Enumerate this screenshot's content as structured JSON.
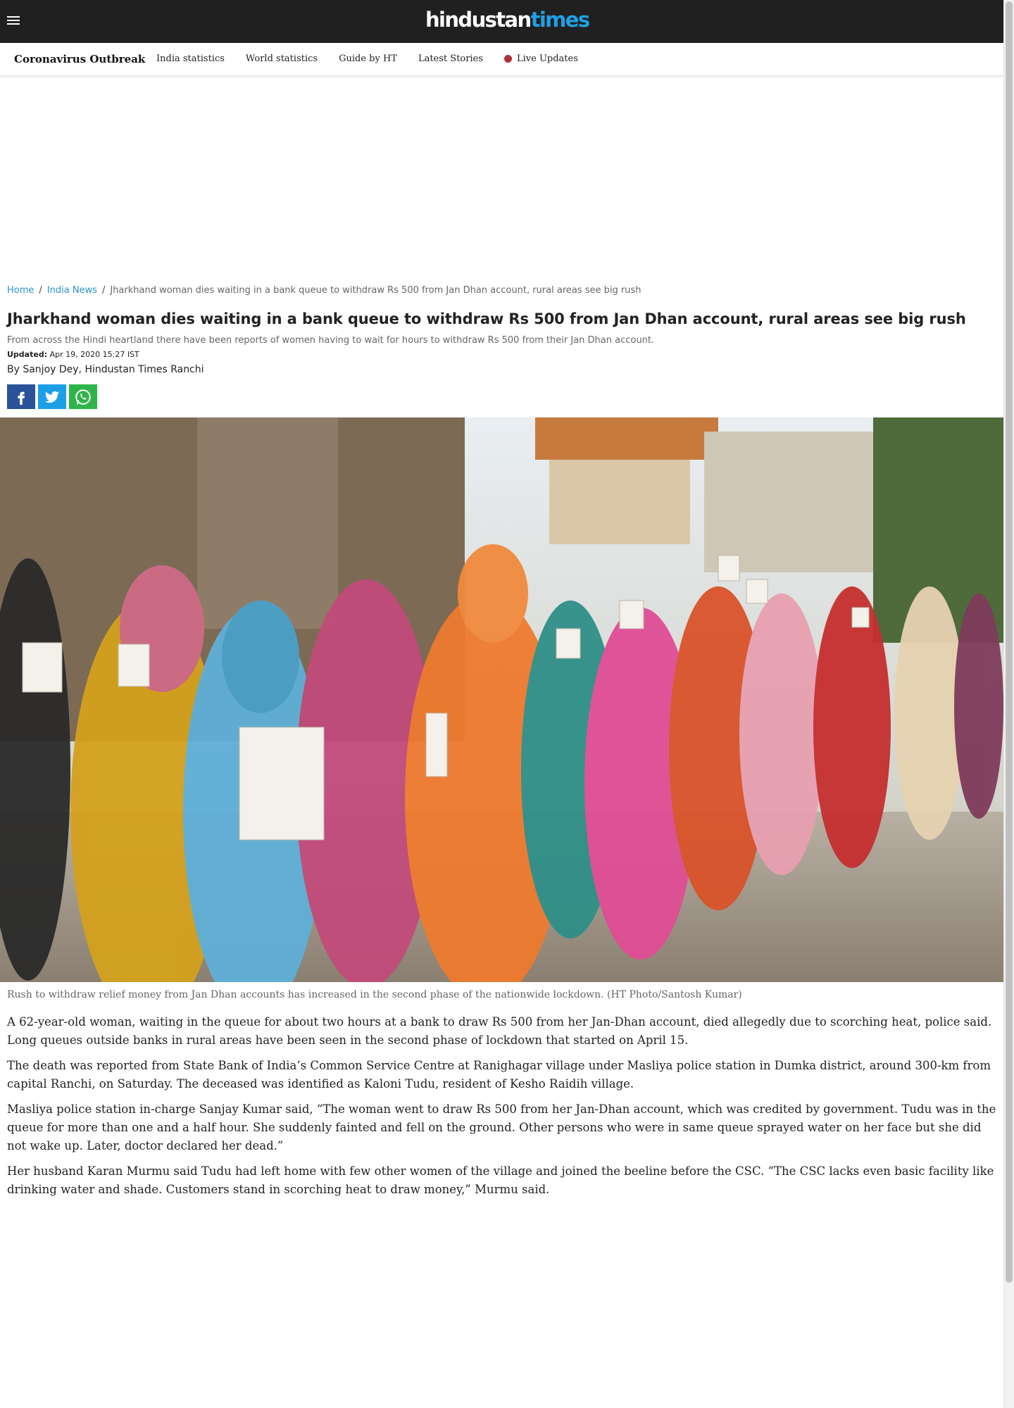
{
  "header": {
    "logo_part1": "hindustan",
    "logo_part2": "times",
    "menu_icon": "hamburger-icon"
  },
  "subnav": {
    "title": "Coronavirus Outbreak",
    "links": [
      "India statistics",
      "World statistics",
      "Guide by HT",
      "Latest Stories"
    ],
    "live_label": "Live Updates"
  },
  "breadcrumb": {
    "home": "Home",
    "section": "India News",
    "current": "Jharkhand woman dies waiting in a bank queue to withdraw Rs 500 from Jan Dhan account, rural areas see big rush"
  },
  "article": {
    "headline": "Jharkhand woman dies waiting in a bank queue to withdraw Rs 500 from Jan Dhan account, rural areas see big rush",
    "summary": "From across the Hindi heartland there have been reports of women having to wait for hours to withdraw Rs 500 from their Jan Dhan account.",
    "updated_label": "Updated:",
    "updated_value": "Apr 19, 2020 15:27 IST",
    "byline": "By Sanjoy Dey, Hindustan Times Ranchi",
    "share": [
      "facebook-icon",
      "twitter-icon",
      "whatsapp-icon"
    ],
    "caption": "Rush to withdraw relief money from Jan Dhan accounts has increased in the second phase of the nationwide lockdown. (HT Photo/Santosh Kumar)",
    "paragraphs": [
      "A 62-year-old woman, waiting in the queue for about two hours at a bank to draw Rs 500 from her Jan-Dhan account, died allegedly due to scorching heat, police said. Long queues outside banks in rural areas have been seen in the second phase of lockdown that started on April 15.",
      "The death was reported from State Bank of India’s Common Service Centre at Ranighagar village under Masliya police station in Dumka district, around 300-km from capital Ranchi, on Saturday. The deceased was identified as Kaloni Tudu, resident of Kesho Raidih village.",
      "Masliya police station in-charge Sanjay Kumar said, “The woman went to draw Rs 500 from her Jan-Dhan account, which was credited by government. Tudu was in the queue for more than one and a half hour. She suddenly fainted and fell on the ground. Other persons who were in same queue sprayed water on her face but she did not wake up. Later, doctor declared her dead.”",
      "Her husband Karan Murmu said Tudu had left home with few other women of the village and joined the beeline before the CSC. “The CSC lacks even basic facility like drinking water and shade. Customers stand in scorching heat to draw money,” Murmu said."
    ]
  },
  "colors": {
    "topbar": "#202020",
    "logo_accent": "#1da1e6",
    "link": "#2f90c8",
    "live_dot": "#b0303a"
  }
}
